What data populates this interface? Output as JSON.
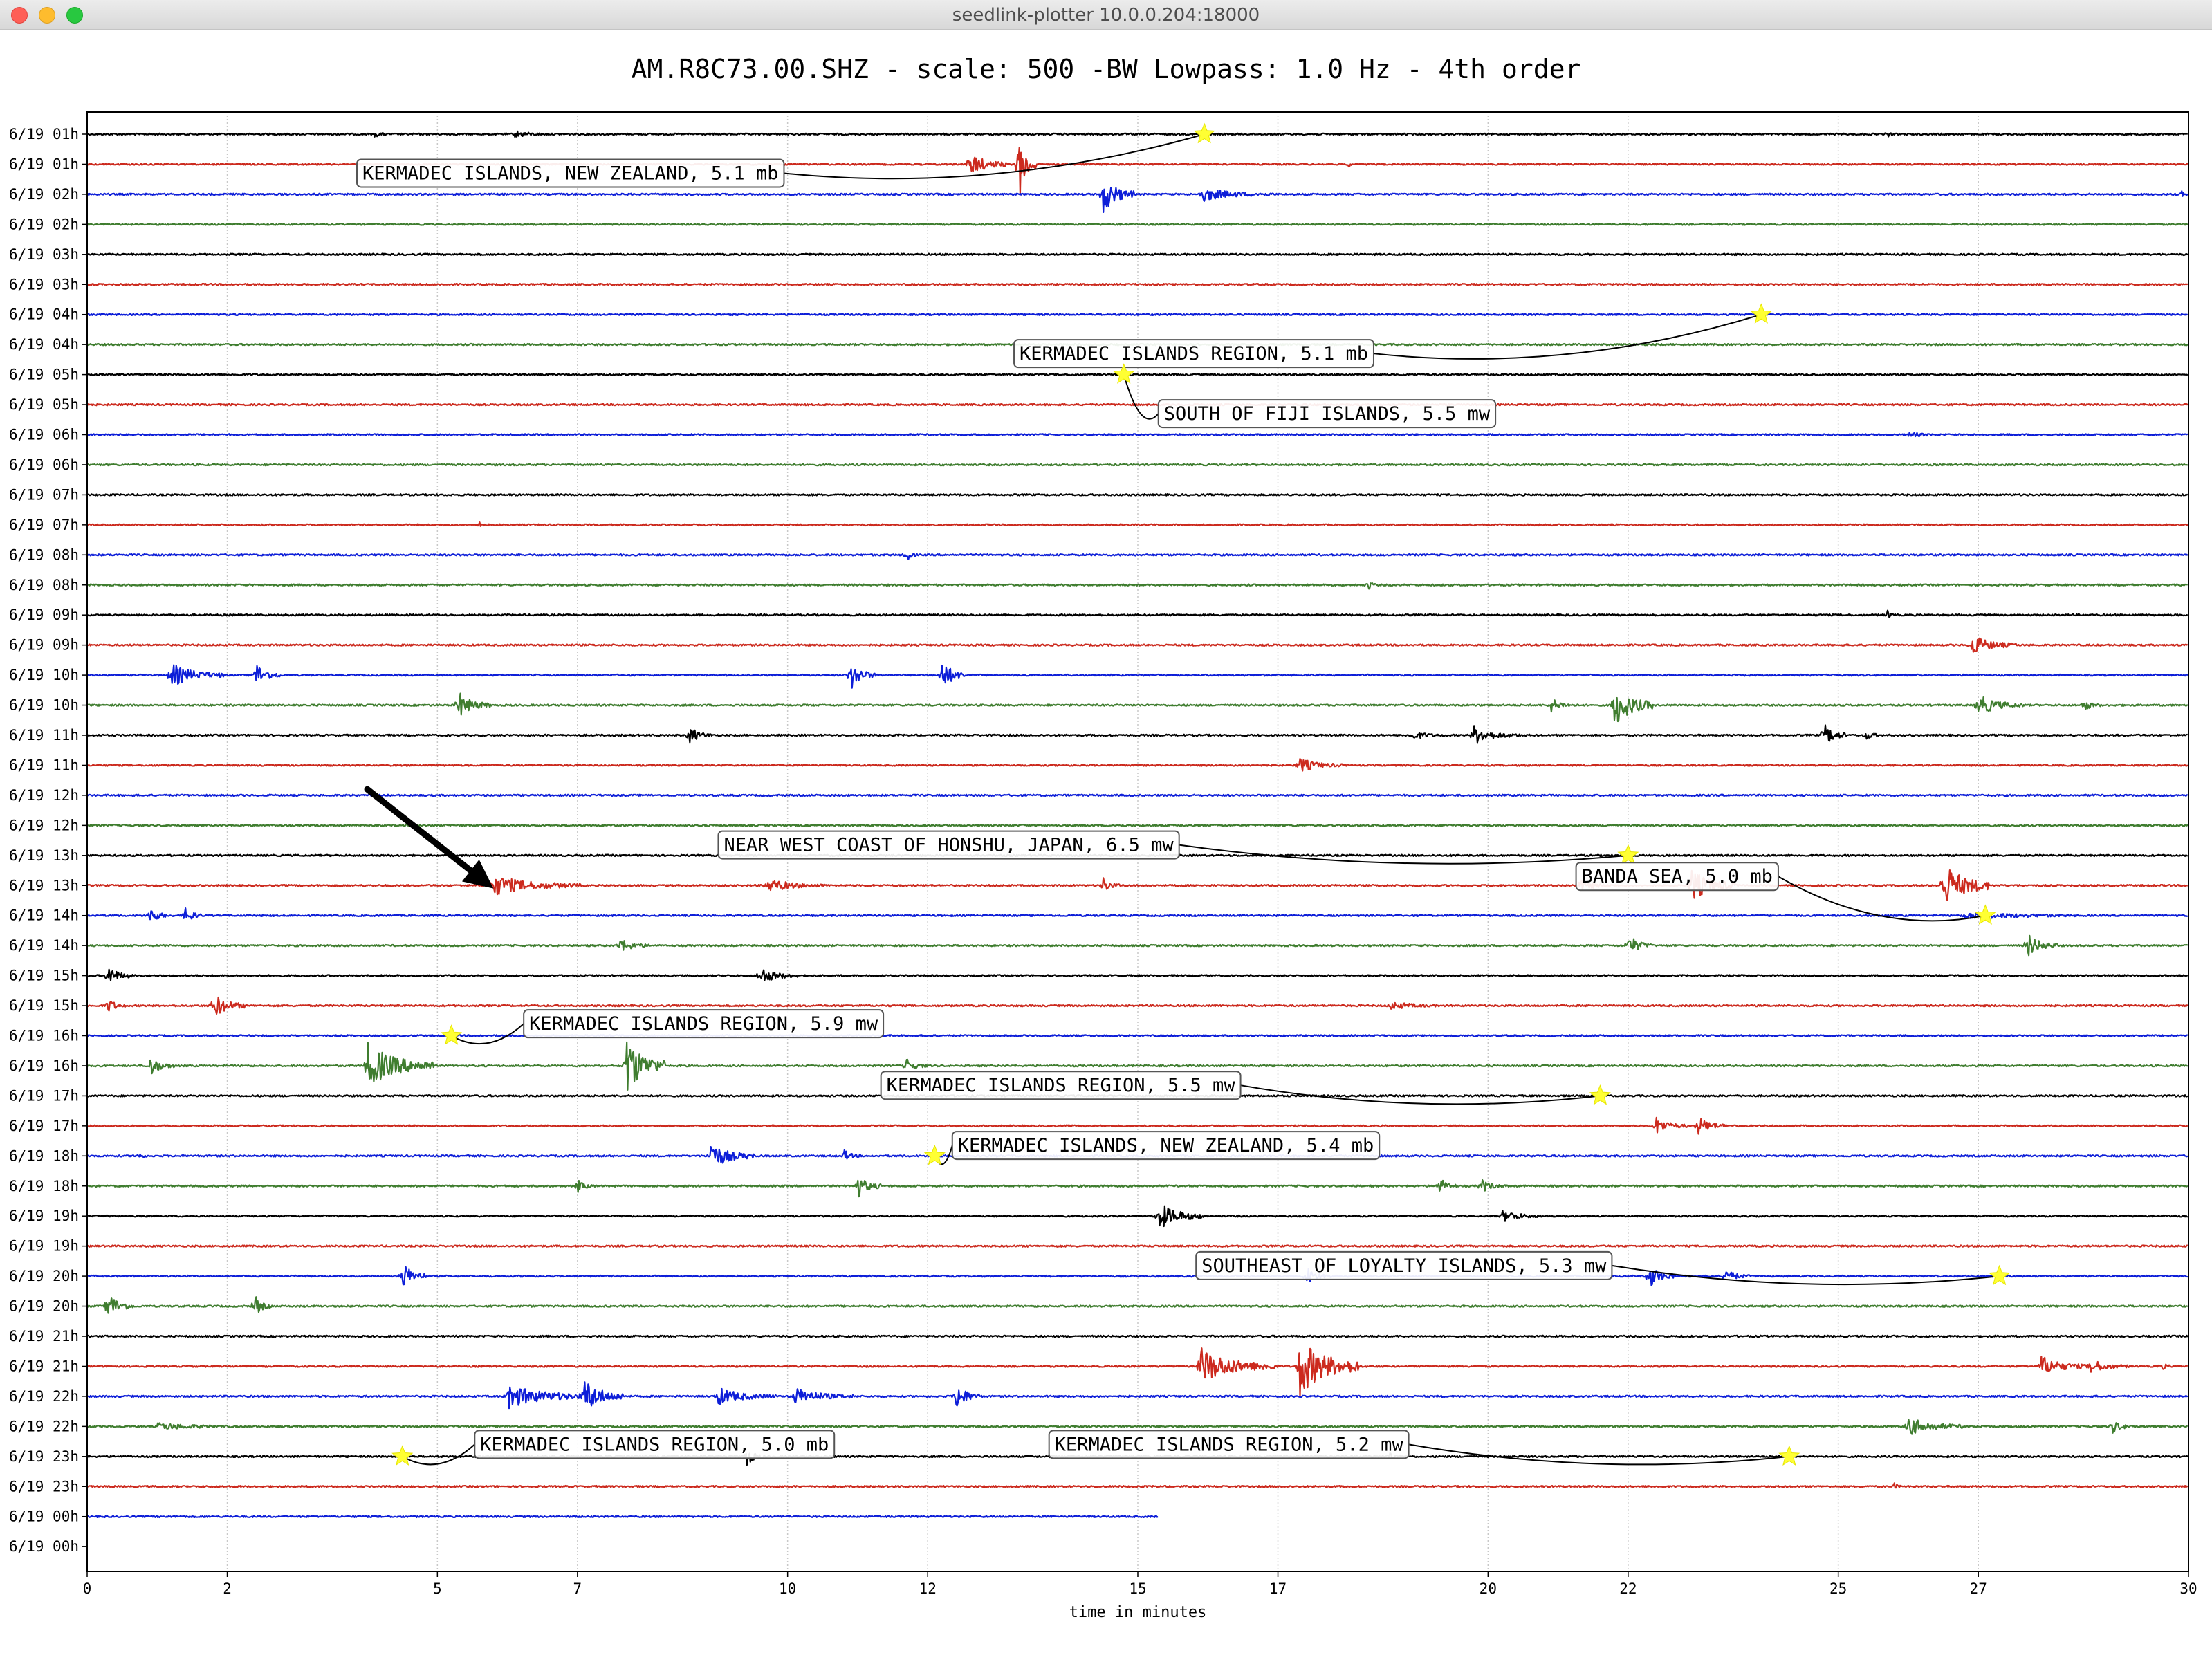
{
  "window": {
    "title": "seedlink-plotter 10.0.0.204:18000"
  },
  "plot": {
    "title": "AM.R8C73.00.SHZ - scale: 500 -BW Lowpass: 1.0 Hz - 4th order"
  },
  "colors": {
    "cycle": [
      "#000000",
      "#cc2a1e",
      "#0d1ed8",
      "#3f7d2f"
    ],
    "marker": "#ffff33",
    "arrow": "#000000"
  },
  "chart_data": {
    "type": "line",
    "xlabel": "time in minutes",
    "xlim": [
      0,
      30
    ],
    "x_ticks": [
      0,
      2,
      5,
      7,
      10,
      12,
      15,
      17,
      20,
      22,
      25,
      27,
      30
    ],
    "x_tick_labels": [
      "0",
      "2",
      "5",
      "7",
      "10",
      "12",
      "15",
      "17",
      "20",
      "22",
      "25",
      "27",
      "30"
    ],
    "grid": "vertical",
    "rows": [
      "6/19 01h",
      "6/19 01h",
      "6/19 02h",
      "6/19 02h",
      "6/19 03h",
      "6/19 03h",
      "6/19 04h",
      "6/19 04h",
      "6/19 05h",
      "6/19 05h",
      "6/19 06h",
      "6/19 06h",
      "6/19 07h",
      "6/19 07h",
      "6/19 08h",
      "6/19 08h",
      "6/19 09h",
      "6/19 09h",
      "6/19 10h",
      "6/19 10h",
      "6/19 11h",
      "6/19 11h",
      "6/19 12h",
      "6/19 12h",
      "6/19 13h",
      "6/19 13h",
      "6/19 14h",
      "6/19 14h",
      "6/19 15h",
      "6/19 15h",
      "6/19 16h",
      "6/19 16h",
      "6/19 17h",
      "6/19 17h",
      "6/19 18h",
      "6/19 18h",
      "6/19 19h",
      "6/19 19h",
      "6/19 20h",
      "6/19 20h",
      "6/19 21h",
      "6/19 21h",
      "6/19 22h",
      "6/19 22h",
      "6/19 23h",
      "6/19 23h",
      "6/19 00h",
      "6/19 00h"
    ],
    "last_trace_end_minutes": 15.3,
    "bursts": [
      {
        "row": 0,
        "t": 4.1,
        "amp": 4,
        "dur": 0.3
      },
      {
        "row": 0,
        "t": 6.1,
        "amp": 5,
        "dur": 0.6
      },
      {
        "row": 0,
        "t": 25.7,
        "amp": 5,
        "dur": 0.1
      },
      {
        "row": 1,
        "t": 12.6,
        "amp": 16,
        "dur": 0.5
      },
      {
        "row": 1,
        "t": 13.3,
        "amp": 50,
        "dur": 0.2
      },
      {
        "row": 1,
        "t": 18.0,
        "amp": 5,
        "dur": 0.1
      },
      {
        "row": 2,
        "t": 14.5,
        "amp": 26,
        "dur": 0.4
      },
      {
        "row": 2,
        "t": 15.9,
        "amp": 10,
        "dur": 1.0
      },
      {
        "row": 2,
        "t": 29.9,
        "amp": 5,
        "dur": 0.1
      },
      {
        "row": 10,
        "t": 26.0,
        "amp": 4,
        "dur": 0.6
      },
      {
        "row": 13,
        "t": 5.6,
        "amp": 5,
        "dur": 0.1
      },
      {
        "row": 14,
        "t": 11.7,
        "amp": 12,
        "dur": 0.1
      },
      {
        "row": 15,
        "t": 18.3,
        "amp": 8,
        "dur": 0.1
      },
      {
        "row": 16,
        "t": 25.7,
        "amp": 8,
        "dur": 0.1
      },
      {
        "row": 17,
        "t": 26.9,
        "amp": 14,
        "dur": 0.6
      },
      {
        "row": 18,
        "t": 1.2,
        "amp": 16,
        "dur": 0.7
      },
      {
        "row": 18,
        "t": 2.4,
        "amp": 18,
        "dur": 0.3
      },
      {
        "row": 18,
        "t": 10.9,
        "amp": 20,
        "dur": 0.3
      },
      {
        "row": 18,
        "t": 12.2,
        "amp": 22,
        "dur": 0.3
      },
      {
        "row": 19,
        "t": 5.3,
        "amp": 18,
        "dur": 0.4
      },
      {
        "row": 19,
        "t": 21.8,
        "amp": 30,
        "dur": 0.5
      },
      {
        "row": 19,
        "t": 20.9,
        "amp": 10,
        "dur": 0.3
      },
      {
        "row": 19,
        "t": 27.0,
        "amp": 14,
        "dur": 0.6
      },
      {
        "row": 19,
        "t": 28.5,
        "amp": 10,
        "dur": 0.2
      },
      {
        "row": 20,
        "t": 8.6,
        "amp": 12,
        "dur": 0.3
      },
      {
        "row": 20,
        "t": 18.9,
        "amp": 6,
        "dur": 0.6
      },
      {
        "row": 20,
        "t": 19.8,
        "amp": 12,
        "dur": 0.6
      },
      {
        "row": 20,
        "t": 24.8,
        "amp": 16,
        "dur": 0.3
      },
      {
        "row": 20,
        "t": 25.4,
        "amp": 8,
        "dur": 0.2
      },
      {
        "row": 21,
        "t": 17.3,
        "amp": 10,
        "dur": 0.6
      },
      {
        "row": 25,
        "t": 5.8,
        "amp": 14,
        "dur": 1.2
      },
      {
        "row": 25,
        "t": 9.7,
        "amp": 10,
        "dur": 0.8
      },
      {
        "row": 25,
        "t": 14.5,
        "amp": 12,
        "dur": 0.2
      },
      {
        "row": 25,
        "t": 21.3,
        "amp": 8,
        "dur": 0.5
      },
      {
        "row": 25,
        "t": 22.9,
        "amp": 22,
        "dur": 0.6
      },
      {
        "row": 25,
        "t": 26.5,
        "amp": 32,
        "dur": 0.6
      },
      {
        "row": 26,
        "t": 0.9,
        "amp": 14,
        "dur": 0.2
      },
      {
        "row": 26,
        "t": 1.4,
        "amp": 14,
        "dur": 0.2
      },
      {
        "row": 26,
        "t": 26.8,
        "amp": 5,
        "dur": 2.4
      },
      {
        "row": 27,
        "t": 7.6,
        "amp": 10,
        "dur": 0.4
      },
      {
        "row": 27,
        "t": 22.0,
        "amp": 16,
        "dur": 0.3
      },
      {
        "row": 27,
        "t": 27.7,
        "amp": 16,
        "dur": 0.4
      },
      {
        "row": 28,
        "t": 0.3,
        "amp": 14,
        "dur": 0.3
      },
      {
        "row": 28,
        "t": 9.6,
        "amp": 12,
        "dur": 0.5
      },
      {
        "row": 29,
        "t": 0.3,
        "amp": 12,
        "dur": 0.2
      },
      {
        "row": 29,
        "t": 1.8,
        "amp": 18,
        "dur": 0.4
      },
      {
        "row": 29,
        "t": 18.6,
        "amp": 6,
        "dur": 0.8
      },
      {
        "row": 31,
        "t": 0.9,
        "amp": 14,
        "dur": 0.3
      },
      {
        "row": 31,
        "t": 4.0,
        "amp": 30,
        "dur": 0.9
      },
      {
        "row": 31,
        "t": 7.7,
        "amp": 40,
        "dur": 0.5
      },
      {
        "row": 31,
        "t": 11.7,
        "amp": 10,
        "dur": 0.3
      },
      {
        "row": 33,
        "t": 22.4,
        "amp": 12,
        "dur": 0.4
      },
      {
        "row": 33,
        "t": 23.0,
        "amp": 12,
        "dur": 0.4
      },
      {
        "row": 34,
        "t": 0.7,
        "amp": 6,
        "dur": 0.2
      },
      {
        "row": 34,
        "t": 8.9,
        "amp": 18,
        "dur": 0.6
      },
      {
        "row": 34,
        "t": 10.8,
        "amp": 10,
        "dur": 0.2
      },
      {
        "row": 35,
        "t": 7.0,
        "amp": 10,
        "dur": 0.2
      },
      {
        "row": 35,
        "t": 11.0,
        "amp": 16,
        "dur": 0.3
      },
      {
        "row": 35,
        "t": 19.3,
        "amp": 14,
        "dur": 0.2
      },
      {
        "row": 35,
        "t": 19.9,
        "amp": 10,
        "dur": 0.3
      },
      {
        "row": 36,
        "t": 15.3,
        "amp": 18,
        "dur": 0.6
      },
      {
        "row": 36,
        "t": 20.2,
        "amp": 8,
        "dur": 0.6
      },
      {
        "row": 38,
        "t": 4.5,
        "amp": 20,
        "dur": 0.3
      },
      {
        "row": 38,
        "t": 17.4,
        "amp": 14,
        "dur": 0.3
      },
      {
        "row": 38,
        "t": 22.3,
        "amp": 18,
        "dur": 0.3
      },
      {
        "row": 38,
        "t": 23.4,
        "amp": 10,
        "dur": 0.3
      },
      {
        "row": 39,
        "t": 0.3,
        "amp": 20,
        "dur": 0.3
      },
      {
        "row": 39,
        "t": 2.4,
        "amp": 14,
        "dur": 0.2
      },
      {
        "row": 41,
        "t": 15.9,
        "amp": 24,
        "dur": 1.0
      },
      {
        "row": 41,
        "t": 17.3,
        "amp": 40,
        "dur": 0.8
      },
      {
        "row": 41,
        "t": 27.9,
        "amp": 14,
        "dur": 0.6
      },
      {
        "row": 41,
        "t": 28.6,
        "amp": 10,
        "dur": 0.5
      },
      {
        "row": 41,
        "t": 29.6,
        "amp": 6,
        "dur": 0.2
      },
      {
        "row": 42,
        "t": 6.0,
        "amp": 16,
        "dur": 1.2
      },
      {
        "row": 42,
        "t": 7.1,
        "amp": 24,
        "dur": 0.5
      },
      {
        "row": 42,
        "t": 9.0,
        "amp": 12,
        "dur": 0.8
      },
      {
        "row": 42,
        "t": 10.1,
        "amp": 12,
        "dur": 0.8
      },
      {
        "row": 42,
        "t": 12.4,
        "amp": 20,
        "dur": 0.3
      },
      {
        "row": 43,
        "t": 1.0,
        "amp": 5,
        "dur": 1.5
      },
      {
        "row": 43,
        "t": 26.0,
        "amp": 12,
        "dur": 0.8
      },
      {
        "row": 43,
        "t": 28.9,
        "amp": 10,
        "dur": 0.3
      },
      {
        "row": 44,
        "t": 9.4,
        "amp": 16,
        "dur": 0.2
      },
      {
        "row": 44,
        "t": 18.6,
        "amp": 8,
        "dur": 0.1
      },
      {
        "row": 45,
        "t": 25.8,
        "amp": 6,
        "dur": 0.1
      }
    ],
    "events": [
      {
        "label": "KERMADEC ISLANDS, NEW ZEALAND, 5.1 mb",
        "star_row": 0,
        "star_t": 15.95,
        "label_row": 1.3,
        "label_t": 6.9
      },
      {
        "label": "KERMADEC ISLANDS REGION, 5.1 mb",
        "star_row": 6,
        "star_t": 23.9,
        "label_row": 7.3,
        "label_t": 15.8
      },
      {
        "label": "SOUTH OF FIJI ISLANDS, 5.5 mw",
        "star_row": 8,
        "star_t": 14.8,
        "label_row": 9.3,
        "label_t": 17.7
      },
      {
        "label": "NEAR WEST COAST OF HONSHU, JAPAN, 6.5 mw",
        "star_row": 24,
        "star_t": 22.0,
        "label_row": 23.65,
        "label_t": 12.3
      },
      {
        "label": "BANDA SEA, 5.0 mb",
        "star_row": 26,
        "star_t": 27.1,
        "label_row": 24.7,
        "label_t": 22.7
      },
      {
        "label": "KERMADEC ISLANDS REGION, 5.9 mw",
        "star_row": 30,
        "star_t": 5.2,
        "label_row": 29.6,
        "label_t": 8.8
      },
      {
        "label": "KERMADEC ISLANDS REGION, 5.5 mw",
        "star_row": 32,
        "star_t": 21.6,
        "label_row": 31.65,
        "label_t": 13.9
      },
      {
        "label": "KERMADEC ISLANDS, NEW ZEALAND, 5.4 mb",
        "star_row": 34,
        "star_t": 12.1,
        "label_row": 33.65,
        "label_t": 15.4
      },
      {
        "label": "SOUTHEAST OF LOYALTY ISLANDS, 5.3 mw",
        "star_row": 38,
        "star_t": 27.3,
        "label_row": 37.65,
        "label_t": 18.8
      },
      {
        "label": "KERMADEC ISLANDS REGION, 5.0 mb",
        "star_row": 44,
        "star_t": 4.5,
        "label_row": 43.6,
        "label_t": 8.1
      },
      {
        "label": "KERMADEC ISLANDS REGION, 5.2 mw",
        "star_row": 44,
        "star_t": 24.3,
        "label_row": 43.6,
        "label_t": 16.3
      }
    ],
    "arrow": {
      "from_row": 21.8,
      "from_t": 4.0,
      "to_row": 25.1,
      "to_t": 5.8
    }
  }
}
